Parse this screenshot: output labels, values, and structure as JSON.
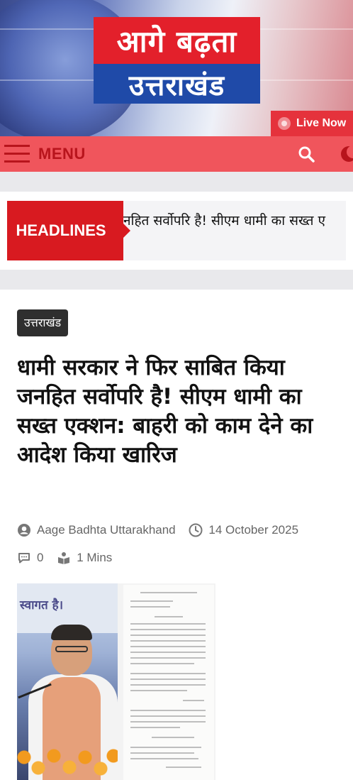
{
  "header": {
    "logo_line1": "आगे बढ़ता",
    "logo_line2": "उत्तराखंड",
    "live_label": "Live Now"
  },
  "nav": {
    "menu_label": "MENU"
  },
  "ticker": {
    "label": "HEADLINES",
    "text": "नहित सर्वोपरि है! सीएम धामी का सख्त ए"
  },
  "article": {
    "category": "उत्तराखंड",
    "title": "धामी सरकार ने फिर साबित किया जनहित सर्वोपरि है! सीएम धामी का सख्त एक्शन: बाहरी को काम देने का आदेश किया खारिज",
    "author": "Aage Badhta Uttarakhand",
    "date": "14 October 2025",
    "comments": "0",
    "read_time": "1 Mins",
    "image_banner_text": "स्वागत है।"
  },
  "colors": {
    "brand_red": "#d81a20",
    "nav_red": "#f0555c",
    "logo_blue": "#1f4aa8"
  }
}
